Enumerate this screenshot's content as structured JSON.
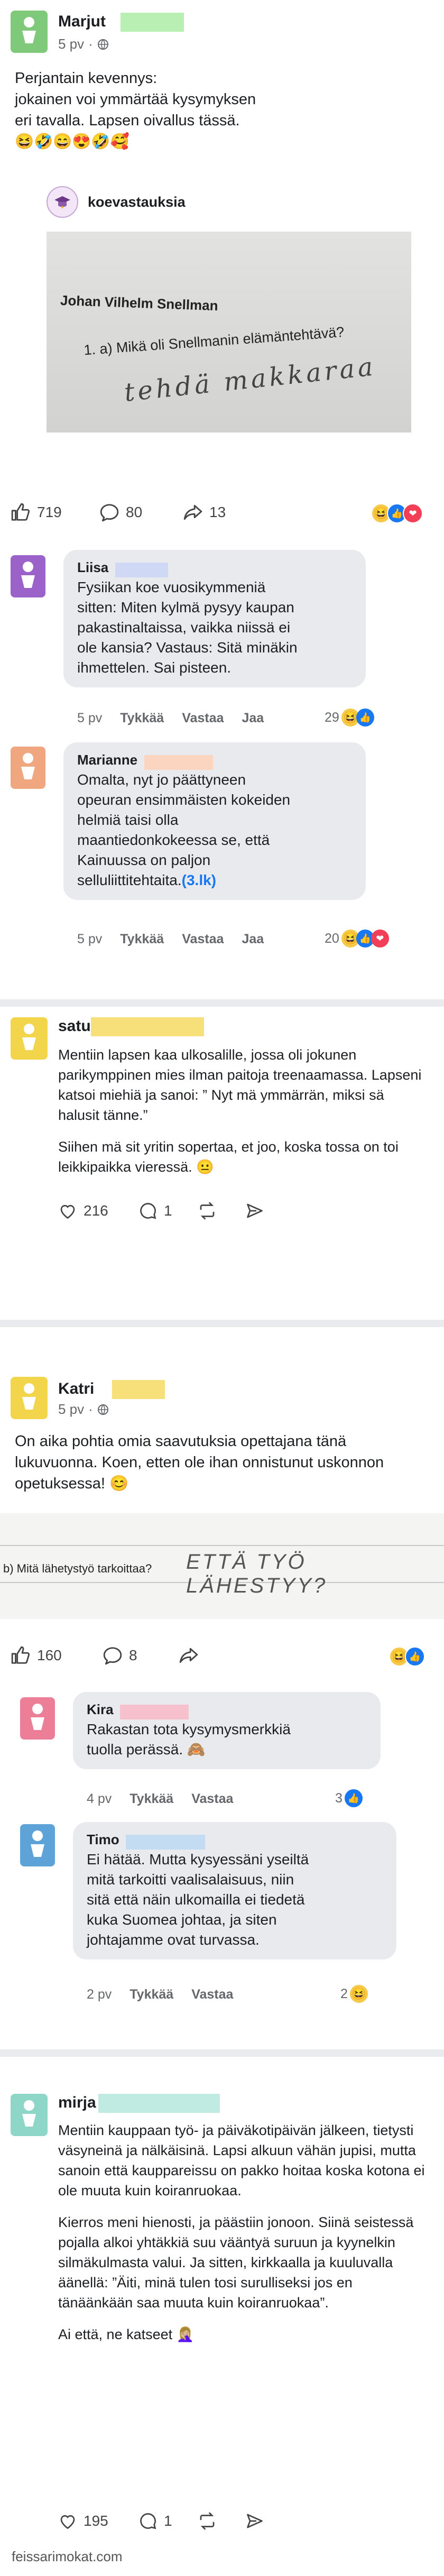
{
  "post1": {
    "name": "Marjut",
    "time": "5 pv",
    "text": "Perjantain kevennys:\njokainen voi ymmärtää kysymyksen\neri tavalla. Lapsen oivallus tässä.\n😆🤣😄😍🤣🥰",
    "shared_account": "koevastauksia",
    "photo_heading": "Johan Vilhelm Snellman",
    "photo_question": "1. a) Mikä oli Snellmanin elämäntehtävä?",
    "photo_answer": "tehdä makkaraa",
    "likes": "719",
    "comments": "80",
    "shares": "13"
  },
  "comment1": {
    "name": "Liisa",
    "text": "Fysiikan koe vuosikymmeniä\nsitten: Miten kylmä pysyy kaupan\npakastinaltaissa, vaikka niissä ei\nole kansia? Vastaus: Sitä minäkin\nihmettelen. Sai pisteen.",
    "time": "5 pv",
    "like": "Tykkää",
    "reply": "Vastaa",
    "share": "Jaa",
    "reactions": "29"
  },
  "comment2": {
    "name": "Marianne",
    "text_before": "Omalta, nyt jo päättyneen\nopeuran ensimmäisten kokeiden\nhelmiä taisi olla\nmaantiedonkokeessa se, että\nKainuussa on paljon\nselluliittitehtaita.",
    "text_link": "(3.lk)",
    "time": "5 pv",
    "like": "Tykkää",
    "reply": "Vastaa",
    "share": "Jaa",
    "reactions": "20"
  },
  "post2": {
    "name": "satu",
    "text1": "Mentiin lapsen kaa ulkosalille, jossa oli jokunen parikymppinen mies ilman paitoja treenaamassa. Lapseni katsoi miehiä ja sanoi: ” Nyt mä ymmärrän, miksi sä halusit tänne.”",
    "text2": "Siihen mä sit yritin sopertaa, et joo, koska tossa on toi leikkipaikka vieressä. 😐",
    "likes": "216",
    "comments": "1"
  },
  "post3": {
    "name": "Katri",
    "time": "5 pv",
    "text": "On aika pohtia omia saavutuksia opettajana tänä lukuvuonna. Koen, etten ole ihan onnistunut uskonnon opetuksessa! 😊",
    "photo_question": "b) Mitä lähetystyö tarkoittaa?",
    "photo_answer": "ETTÄ TYÖ LÄHESTYY?",
    "likes": "160",
    "comments": "8"
  },
  "comment3": {
    "name": "Kira",
    "text": "Rakastan tota kysymysmerkkiä\ntuolla perässä. 🙈",
    "time": "4 pv",
    "like": "Tykkää",
    "reply": "Vastaa",
    "reactions": "3"
  },
  "comment4": {
    "name": "Timo",
    "text": "Ei hätää. Mutta kysyessäni yseiltä\nmitä tarkoitti vaalisalaisuus, niin\nsitä että näin ulkomailla ei tiedetä\nkuka Suomea johtaa, ja siten\njohtajamme ovat turvassa.",
    "time": "2 pv",
    "like": "Tykkää",
    "reply": "Vastaa",
    "reactions": "2"
  },
  "post4": {
    "name": "mirja",
    "text1": "Mentiin kauppaan työ- ja päiväkotipäivän jälkeen, tietysti väsyneinä ja nälkäisinä. Lapsi alkuun vähän jupisi, mutta sanoin että kauppareissu on pakko hoitaa koska kotona ei ole muuta kuin koiranruokaa.",
    "text2": "Kierros meni hienosti, ja päästiin jonoon. Siinä seistessä pojalla alkoi yhtäkkiä suu vääntyä suruun ja kyynelkin silmäkulmasta valui. Ja sitten, kirkkaalla ja kuuluvalla äänellä: ”Äiti, minä tulen tosi surulliseksi jos en tänäänkään saa muuta kuin koiranruokaa”.",
    "text3": "Ai että, ne katseet 🤦🏼‍♀️",
    "likes": "195",
    "comments": "1"
  },
  "footer": "feissarimokat.com",
  "colors": {
    "avatar_green": "#7fc97a",
    "avatar_purple": "#9b63c9",
    "avatar_orange": "#f0a77f",
    "avatar_yellow": "#f2d54a",
    "avatar_pink": "#ec7f97",
    "avatar_blue": "#5ea3d8",
    "avatar_teal": "#8ed6c8",
    "link_blue": "#1877f2"
  }
}
